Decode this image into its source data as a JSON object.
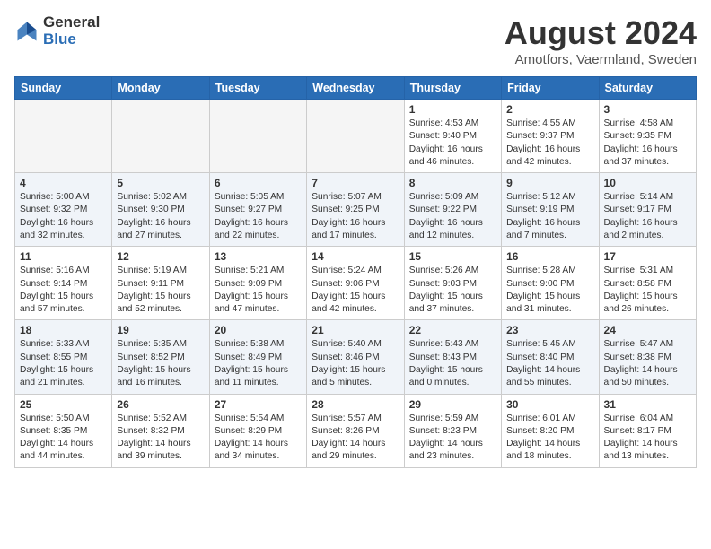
{
  "header": {
    "logo_general": "General",
    "logo_blue": "Blue",
    "month_year": "August 2024",
    "location": "Amotfors, Vaermland, Sweden"
  },
  "days_of_week": [
    "Sunday",
    "Monday",
    "Tuesday",
    "Wednesday",
    "Thursday",
    "Friday",
    "Saturday"
  ],
  "weeks": [
    [
      {
        "day": "",
        "info": ""
      },
      {
        "day": "",
        "info": ""
      },
      {
        "day": "",
        "info": ""
      },
      {
        "day": "",
        "info": ""
      },
      {
        "day": "1",
        "info": "Sunrise: 4:53 AM\nSunset: 9:40 PM\nDaylight: 16 hours\nand 46 minutes."
      },
      {
        "day": "2",
        "info": "Sunrise: 4:55 AM\nSunset: 9:37 PM\nDaylight: 16 hours\nand 42 minutes."
      },
      {
        "day": "3",
        "info": "Sunrise: 4:58 AM\nSunset: 9:35 PM\nDaylight: 16 hours\nand 37 minutes."
      }
    ],
    [
      {
        "day": "4",
        "info": "Sunrise: 5:00 AM\nSunset: 9:32 PM\nDaylight: 16 hours\nand 32 minutes."
      },
      {
        "day": "5",
        "info": "Sunrise: 5:02 AM\nSunset: 9:30 PM\nDaylight: 16 hours\nand 27 minutes."
      },
      {
        "day": "6",
        "info": "Sunrise: 5:05 AM\nSunset: 9:27 PM\nDaylight: 16 hours\nand 22 minutes."
      },
      {
        "day": "7",
        "info": "Sunrise: 5:07 AM\nSunset: 9:25 PM\nDaylight: 16 hours\nand 17 minutes."
      },
      {
        "day": "8",
        "info": "Sunrise: 5:09 AM\nSunset: 9:22 PM\nDaylight: 16 hours\nand 12 minutes."
      },
      {
        "day": "9",
        "info": "Sunrise: 5:12 AM\nSunset: 9:19 PM\nDaylight: 16 hours\nand 7 minutes."
      },
      {
        "day": "10",
        "info": "Sunrise: 5:14 AM\nSunset: 9:17 PM\nDaylight: 16 hours\nand 2 minutes."
      }
    ],
    [
      {
        "day": "11",
        "info": "Sunrise: 5:16 AM\nSunset: 9:14 PM\nDaylight: 15 hours\nand 57 minutes."
      },
      {
        "day": "12",
        "info": "Sunrise: 5:19 AM\nSunset: 9:11 PM\nDaylight: 15 hours\nand 52 minutes."
      },
      {
        "day": "13",
        "info": "Sunrise: 5:21 AM\nSunset: 9:09 PM\nDaylight: 15 hours\nand 47 minutes."
      },
      {
        "day": "14",
        "info": "Sunrise: 5:24 AM\nSunset: 9:06 PM\nDaylight: 15 hours\nand 42 minutes."
      },
      {
        "day": "15",
        "info": "Sunrise: 5:26 AM\nSunset: 9:03 PM\nDaylight: 15 hours\nand 37 minutes."
      },
      {
        "day": "16",
        "info": "Sunrise: 5:28 AM\nSunset: 9:00 PM\nDaylight: 15 hours\nand 31 minutes."
      },
      {
        "day": "17",
        "info": "Sunrise: 5:31 AM\nSunset: 8:58 PM\nDaylight: 15 hours\nand 26 minutes."
      }
    ],
    [
      {
        "day": "18",
        "info": "Sunrise: 5:33 AM\nSunset: 8:55 PM\nDaylight: 15 hours\nand 21 minutes."
      },
      {
        "day": "19",
        "info": "Sunrise: 5:35 AM\nSunset: 8:52 PM\nDaylight: 15 hours\nand 16 minutes."
      },
      {
        "day": "20",
        "info": "Sunrise: 5:38 AM\nSunset: 8:49 PM\nDaylight: 15 hours\nand 11 minutes."
      },
      {
        "day": "21",
        "info": "Sunrise: 5:40 AM\nSunset: 8:46 PM\nDaylight: 15 hours\nand 5 minutes."
      },
      {
        "day": "22",
        "info": "Sunrise: 5:43 AM\nSunset: 8:43 PM\nDaylight: 15 hours\nand 0 minutes."
      },
      {
        "day": "23",
        "info": "Sunrise: 5:45 AM\nSunset: 8:40 PM\nDaylight: 14 hours\nand 55 minutes."
      },
      {
        "day": "24",
        "info": "Sunrise: 5:47 AM\nSunset: 8:38 PM\nDaylight: 14 hours\nand 50 minutes."
      }
    ],
    [
      {
        "day": "25",
        "info": "Sunrise: 5:50 AM\nSunset: 8:35 PM\nDaylight: 14 hours\nand 44 minutes."
      },
      {
        "day": "26",
        "info": "Sunrise: 5:52 AM\nSunset: 8:32 PM\nDaylight: 14 hours\nand 39 minutes."
      },
      {
        "day": "27",
        "info": "Sunrise: 5:54 AM\nSunset: 8:29 PM\nDaylight: 14 hours\nand 34 minutes."
      },
      {
        "day": "28",
        "info": "Sunrise: 5:57 AM\nSunset: 8:26 PM\nDaylight: 14 hours\nand 29 minutes."
      },
      {
        "day": "29",
        "info": "Sunrise: 5:59 AM\nSunset: 8:23 PM\nDaylight: 14 hours\nand 23 minutes."
      },
      {
        "day": "30",
        "info": "Sunrise: 6:01 AM\nSunset: 8:20 PM\nDaylight: 14 hours\nand 18 minutes."
      },
      {
        "day": "31",
        "info": "Sunrise: 6:04 AM\nSunset: 8:17 PM\nDaylight: 14 hours\nand 13 minutes."
      }
    ]
  ]
}
